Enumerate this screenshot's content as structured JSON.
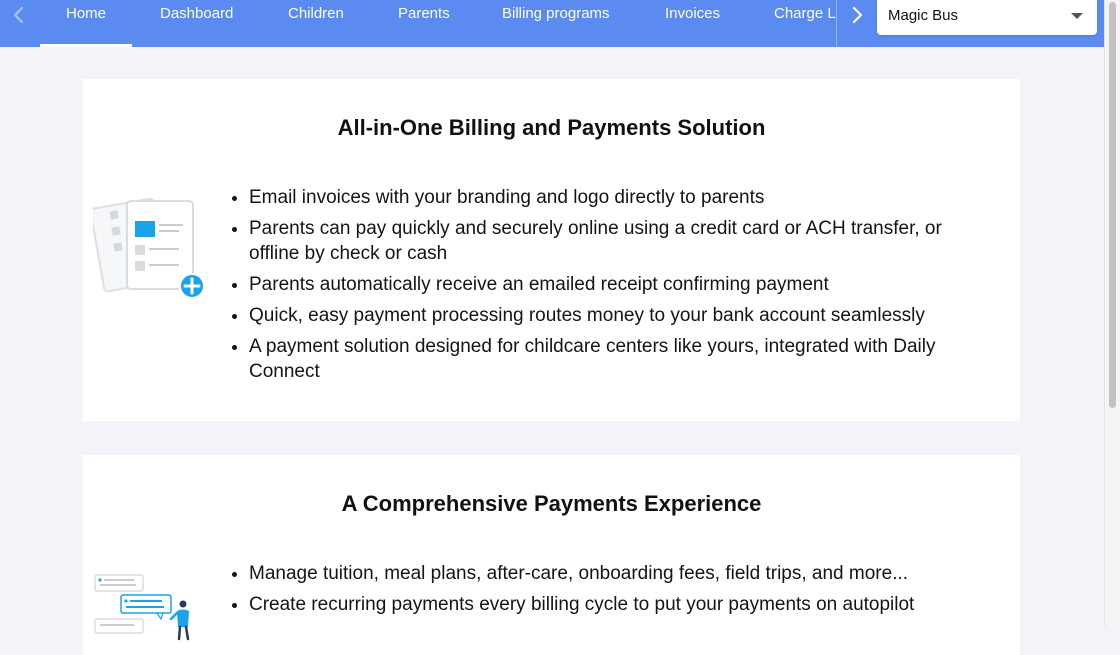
{
  "nav": {
    "tabs": [
      {
        "label": "Home",
        "active": true
      },
      {
        "label": "Dashboard",
        "active": false
      },
      {
        "label": "Children",
        "active": false
      },
      {
        "label": "Parents",
        "active": false
      },
      {
        "label": "Billing programs",
        "active": false
      },
      {
        "label": "Invoices",
        "active": false
      },
      {
        "label": "Charge L",
        "active": false
      }
    ],
    "center_select": {
      "value": "Magic Bus"
    },
    "colors": {
      "bar": "#5b8af0",
      "text": "#ffffff"
    }
  },
  "sections": [
    {
      "title": "All-in-One Billing and Payments Solution",
      "icon": "invoice-plus-illustration-icon",
      "bullets": [
        "Email invoices with your branding and logo directly to parents",
        "Parents can pay quickly and securely online using a credit card or ACH transfer, or offline by check or cash",
        "Parents automatically receive an emailed receipt confirming payment",
        "Quick, easy payment processing routes money to your bank account seamlessly",
        "A payment solution designed for childcare centers like yours, integrated with Daily Connect"
      ]
    },
    {
      "title": "A Comprehensive Payments Experience",
      "icon": "person-messages-illustration-icon",
      "bullets": [
        "Manage tuition, meal plans, after-care, onboarding fees, field trips, and more...",
        "Create recurring payments every billing cycle to put your payments on autopilot"
      ]
    }
  ],
  "colors": {
    "accent": "#1aa3e8",
    "page_bg": "#f2f4f9",
    "card_bg": "#ffffff"
  }
}
